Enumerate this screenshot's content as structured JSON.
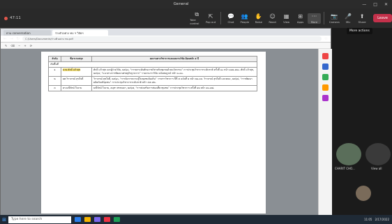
{
  "window": {
    "title": "General",
    "controls": [
      "—",
      "□",
      "✕"
    ]
  },
  "meeting": {
    "timer": "47:11",
    "controls": [
      {
        "label": "Take control",
        "icon": "⧉"
      },
      {
        "label": "Pop out",
        "icon": "⇱"
      },
      {
        "label": "Chat",
        "icon": "💬"
      },
      {
        "label": "People",
        "icon": "👥"
      },
      {
        "label": "Raise",
        "icon": "✋"
      },
      {
        "label": "React",
        "icon": "☺"
      },
      {
        "label": "View",
        "icon": "▦"
      },
      {
        "label": "Apps",
        "icon": "⊞"
      },
      {
        "label": "More",
        "icon": "···"
      },
      {
        "label": "Camera",
        "icon": "📷"
      },
      {
        "label": "Mic",
        "icon": "🎤"
      },
      {
        "label": "Share",
        "icon": "⬆"
      }
    ],
    "leave_label": "Leave",
    "tooltip": "More actions"
  },
  "browser": {
    "tabs": [
      "ตาม conversation",
      "ร่างตัวอย่าง ทบ ฯ วิจัยฯ"
    ],
    "url": "C:/Users/Documents/ร่างตัวอย่าง ทบ.pdf"
  },
  "pdf": {
    "headers": [
      "ลำดับ",
      "ชื่อ-นามสกุล",
      "ผลงานทางวิชาการและผลงานวิจัย ย้อนหลัง ๕ ปี"
    ],
    "section": "เชิงพื้นที่",
    "rows": [
      {
        "no": "๑",
        "name": "นาย ศักดิ์ แก้วสุข",
        "text": "ศักดิ์ แก้วสุข และผู้ร่วมวิจัย, ๒๕๖๓, “การยกระดับศักยภาพวิสาหกิจชุมชนด้วยนวัตกรรม” การประชุมวิชาการระดับชาติ ครั้งที่ ๑๐ หน้า ๑๑๒-๑๒๐. ศักดิ์ แก้วสุข, ๒๕๖๔, “แนวทางการพัฒนาเศรษฐกิจฐานราก” รายงานการวิจัย ฉบับสมบูรณ์ หน้า ๑-๘๐."
      },
      {
        "no": "๒",
        "name": "ผศ.วิราภรณ์ สุขใจดี",
        "text": "วิราภรณ์ สุขใจดี, ๒๕๖๓, “การจัดการความรู้ในชุมชนท้องถิ่น” วารสารวิชาการ ปีที่ ๕ ฉบับที่ ๒ หน้า ๒๑-๓๓. วิราภรณ์ สุขใจดี และคณะ, ๒๕๖๔, “การพัฒนาผลิตภัณฑ์ชุมชน” การประชุมวิชาการระดับชาติ หน้า ๔๕-๕๒."
      },
      {
        "no": "๓",
        "name": "ดร.มณีรัตน์ ใจงาม",
        "text": "มณีรัตน์ ใจงาม, อนุชา พรหมมา, ๒๕๖๕, “การส่งเสริมการท่องเที่ยวชุมชน” การประชุมวิชาการ ครั้งที่ ๑๒ หน้า ๗๐-๗๘."
      }
    ]
  },
  "participants": [
    {
      "name": "CHARIT CHO..."
    }
  ],
  "view_all": "View all",
  "taskbar": {
    "search_placeholder": "Type here to search",
    "time": "11:05",
    "date": "2/17/2022"
  }
}
